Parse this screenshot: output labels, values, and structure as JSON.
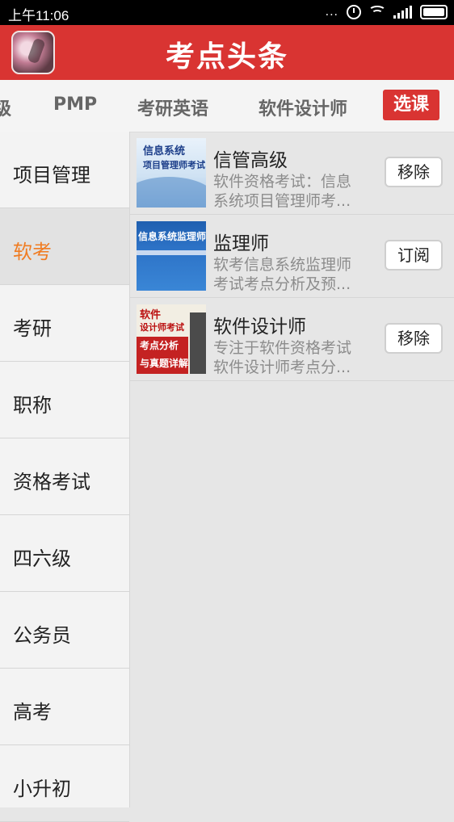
{
  "status_bar": {
    "time": "上午11:06",
    "dots": "..."
  },
  "header": {
    "title": "考点头条"
  },
  "tabs": [
    {
      "label": "级"
    },
    {
      "label": "PMP"
    },
    {
      "label": "考研英语"
    },
    {
      "label": "软件设计师"
    }
  ],
  "select_button": "选课",
  "sidebar": {
    "items": [
      {
        "label": "项目管理"
      },
      {
        "label": "软考",
        "active": true
      },
      {
        "label": "考研"
      },
      {
        "label": "职称"
      },
      {
        "label": "资格考试"
      },
      {
        "label": "四六级"
      },
      {
        "label": "公务员"
      },
      {
        "label": "高考"
      },
      {
        "label": "小升初"
      }
    ]
  },
  "courses": [
    {
      "title": "信管高级",
      "desc_line1": "软件资格考试：信息",
      "desc_line2": "系统项目管理师考...",
      "button": "移除",
      "thumb": {
        "line1": "信息系统",
        "line2": "项目管理师考试"
      }
    },
    {
      "title": "监理师",
      "desc_line1": "软考信息系统监理师",
      "desc_line2": "考试考点分析及预...",
      "button": "订阅",
      "thumb": {
        "line1": "信息系统监理师"
      }
    },
    {
      "title": "软件设计师",
      "desc_line1": "专注于软件资格考试",
      "desc_line2": "软件设计师考点分...",
      "button": "移除",
      "thumb": {
        "line1": "软件",
        "line2": "设计师考试",
        "line3": "考点分析",
        "line4": "与真题详解"
      }
    }
  ],
  "colors": {
    "accent": "#d93432",
    "active_text": "#f07c22"
  }
}
